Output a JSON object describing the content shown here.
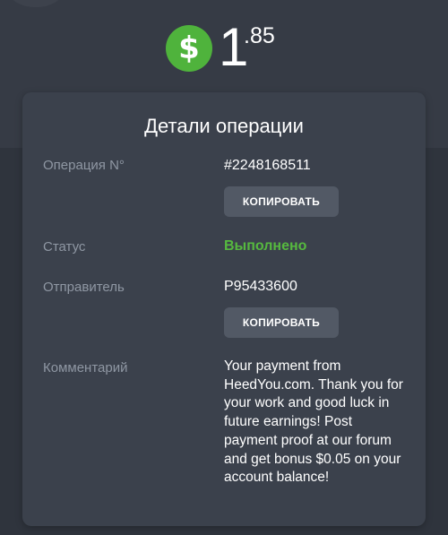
{
  "header": {
    "currency_symbol": "$",
    "amount_integer": "1",
    "amount_fraction": ".85",
    "badge_color": "#4fb33c"
  },
  "details": {
    "title": "Детали операции",
    "operation": {
      "label": "Операция N°",
      "value": "#2248168511",
      "copy_label": "КОПИРОВАТЬ"
    },
    "status": {
      "label": "Статус",
      "value": "Выполнено",
      "color": "#56b93f"
    },
    "sender": {
      "label": "Отправитель",
      "value": "P95433600",
      "copy_label": "КОПИРОВАТЬ"
    },
    "comment": {
      "label": "Комментарий",
      "value": "Your payment from HeedYou.com. Thank you for your work and good luck in future earnings! Post payment proof at our forum and get bonus $0.05 on your account balance!"
    }
  }
}
